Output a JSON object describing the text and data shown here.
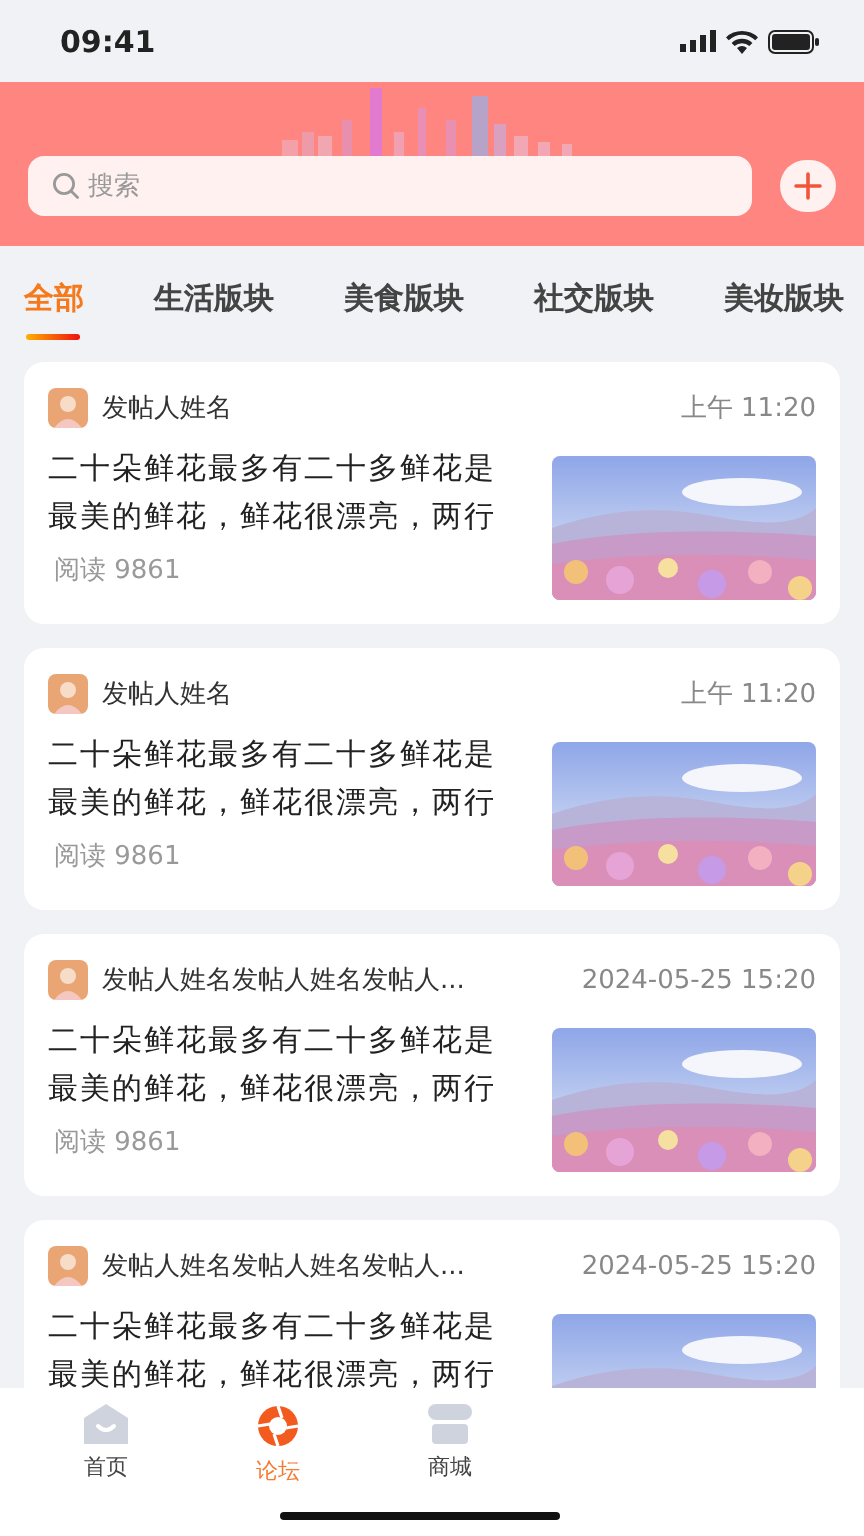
{
  "status_bar": {
    "time": "09:41"
  },
  "search": {
    "placeholder": "搜索"
  },
  "tabs": [
    {
      "label": "全部",
      "selected": true
    },
    {
      "label": "生活版块",
      "selected": false
    },
    {
      "label": "美食版块",
      "selected": false
    },
    {
      "label": "社交版块",
      "selected": false
    },
    {
      "label": "美妆版块",
      "selected": false
    }
  ],
  "posts": [
    {
      "author": "发帖人姓名",
      "time": "上午 11:20",
      "text": "二十朵鲜花最多有二十多鲜花是最美的鲜花，鲜花很漂亮，两行",
      "reads": "阅读 9861"
    },
    {
      "author": "发帖人姓名",
      "time": "上午 11:20",
      "text": "二十朵鲜花最多有二十多鲜花是最美的鲜花，鲜花很漂亮，两行",
      "reads": "阅读 9861"
    },
    {
      "author": "发帖人姓名发帖人姓名发帖人...",
      "time": "2024-05-25 15:20",
      "text": "二十朵鲜花最多有二十多鲜花是最美的鲜花，鲜花很漂亮，两行",
      "reads": "阅读 9861"
    },
    {
      "author": "发帖人姓名发帖人姓名发帖人...",
      "time": "2024-05-25 15:20",
      "text": "二十朵鲜花最多有二十多鲜花是最美的鲜花，鲜花很漂亮，两行"
    }
  ],
  "nav": [
    {
      "label": "首页",
      "kind": "home",
      "selected": false
    },
    {
      "label": "论坛",
      "kind": "forum",
      "selected": true
    },
    {
      "label": "商城",
      "kind": "shop",
      "selected": false
    }
  ]
}
